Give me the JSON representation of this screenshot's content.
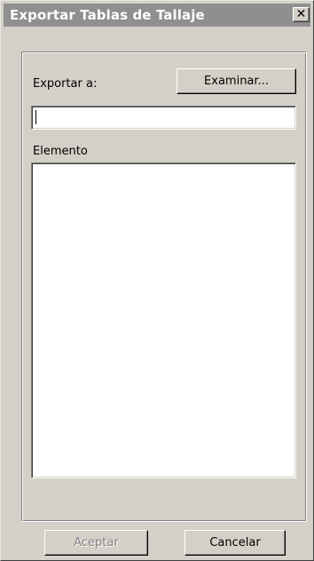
{
  "window": {
    "title": "Exportar Tablas de Tallaje",
    "close_glyph": "✕"
  },
  "export": {
    "label": "Exportar a:",
    "browse_label": "Examinar...",
    "path_value": ""
  },
  "elements": {
    "label": "Elemento",
    "items": []
  },
  "footer": {
    "accept_label": "Aceptar",
    "accept_enabled": false,
    "cancel_label": "Cancelar"
  }
}
